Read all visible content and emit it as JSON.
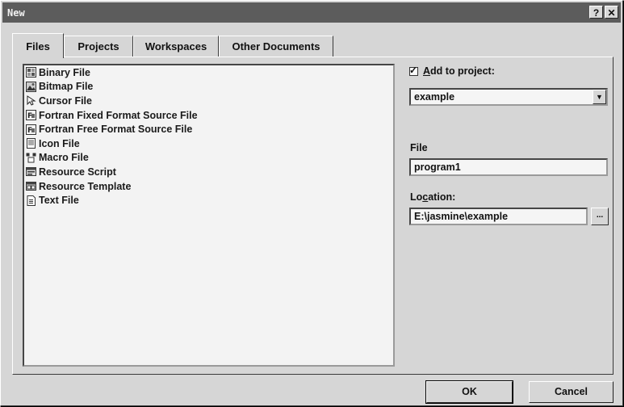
{
  "window": {
    "title": "New",
    "help_glyph": "?",
    "close_glyph": "✕"
  },
  "tabs": [
    {
      "label": "Files",
      "active": true
    },
    {
      "label": "Projects",
      "active": false
    },
    {
      "label": "Workspaces",
      "active": false
    },
    {
      "label": "Other Documents",
      "active": false
    }
  ],
  "file_types": [
    {
      "label": "Binary File",
      "icon": "binary-file-icon"
    },
    {
      "label": "Bitmap File",
      "icon": "bitmap-file-icon"
    },
    {
      "label": "Cursor File",
      "icon": "cursor-file-icon"
    },
    {
      "label": "Fortran Fixed Format Source File",
      "icon": "fortran-fixed-file-icon"
    },
    {
      "label": "Fortran Free Format Source File",
      "icon": "fortran-free-file-icon"
    },
    {
      "label": "Icon File",
      "icon": "icon-file-icon"
    },
    {
      "label": "Macro File",
      "icon": "macro-file-icon"
    },
    {
      "label": "Resource Script",
      "icon": "resource-script-icon"
    },
    {
      "label": "Resource Template",
      "icon": "resource-template-icon"
    },
    {
      "label": "Text File",
      "icon": "text-file-icon"
    }
  ],
  "add_to_project": {
    "checked": true,
    "label_accel": "A",
    "label_rest": "dd to project:",
    "selected": "example"
  },
  "file_field": {
    "label": "File",
    "value": "program1"
  },
  "location_field": {
    "label_pre": "Lo",
    "label_accel": "c",
    "label_post": "ation:",
    "value": "E:\\jasmine\\example",
    "browse_label": "..."
  },
  "buttons": {
    "ok": "OK",
    "cancel": "Cancel"
  }
}
